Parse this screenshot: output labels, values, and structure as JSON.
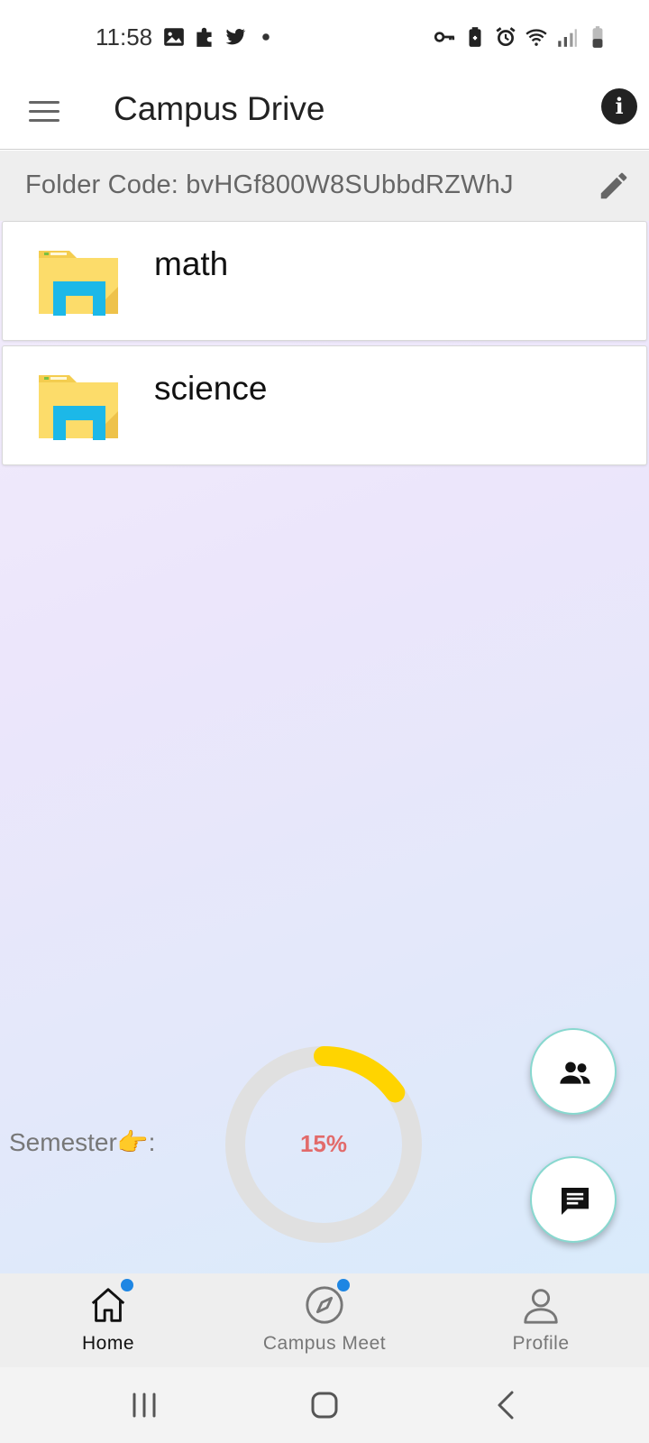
{
  "status_bar": {
    "time": "11:58"
  },
  "app_bar": {
    "title": "Campus Drive"
  },
  "folder_code": {
    "text": "Folder Code: bvHGf800W8SUbbdRZWhJ"
  },
  "folders": [
    {
      "name": "math"
    },
    {
      "name": "science"
    }
  ],
  "semester": {
    "label": "Semester👉:",
    "progress_text": "15%",
    "progress_fraction": 0.15,
    "colors": {
      "track": "#e0e0e0",
      "fill": "#ffd400",
      "text": "#e26a6a"
    }
  },
  "bottom_nav": {
    "items": [
      {
        "label": "Home",
        "icon": "home-icon",
        "active": true
      },
      {
        "label": "Campus Meet",
        "icon": "compass-icon",
        "active": false
      },
      {
        "label": "Profile",
        "icon": "person-icon",
        "active": false
      }
    ]
  },
  "colors": {
    "badge": "#1e86e3",
    "fab_border": "#88d8cf"
  }
}
